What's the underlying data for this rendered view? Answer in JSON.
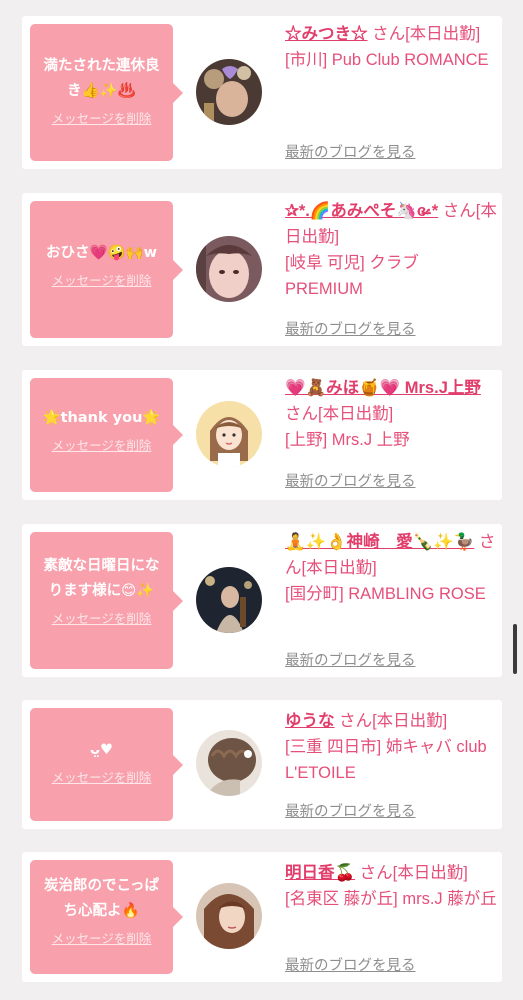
{
  "delete_label": "メッセージを削除",
  "blog_link_label": "最新のブログを見る",
  "cards": [
    {
      "message": "満たされた連休良き👍✨♨️",
      "name": "☆みつき☆",
      "honorific": "さん[本日出勤]",
      "shop": "[市川] Pub Club ROMANCE"
    },
    {
      "message": "おひさ💗🤪🙌w",
      "name": "✰*.🌈あみぺそ🦄ɞ̴̶̷·*",
      "honorific": "さん[本日出勤]",
      "shop": "[岐阜 可児] クラブ PREMIUM"
    },
    {
      "message": "🌟thank you🌟",
      "name": "💗🧸みほ🍯💗 Mrs.J上野",
      "honorific": "さん[本日出勤]",
      "shop": "[上野] Mrs.J 上野"
    },
    {
      "message": "素敵な日曜日になります様に😊✨",
      "name": "🧘✨👌神崎　愛🍾✨🦆",
      "honorific": "さん[本日出勤]",
      "shop": "[国分町] RAMBLING ROSE"
    },
    {
      "message": "ᴗ̤♥",
      "name": "ゆうな",
      "honorific": "さん[本日出勤]",
      "shop": "[三重 四日市] 姉キャバ club L'ETOILE"
    },
    {
      "message": "炭治郎のでこっぱち心配よ🔥",
      "name": "明日香🍒",
      "honorific": "さん[本日出勤]",
      "shop": "[名東区 藤が丘] mrs.J 藤が丘"
    }
  ]
}
